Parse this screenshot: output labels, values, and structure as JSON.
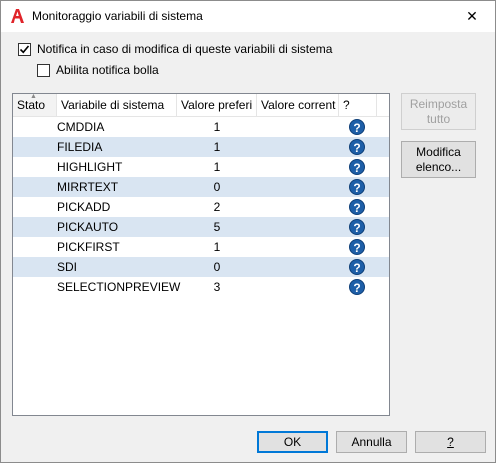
{
  "window": {
    "title": "Monitoraggio variabili di sistema",
    "close_label": "✕"
  },
  "options": {
    "notify_label": "Notifica in caso di modifica di queste variabili di sistema",
    "notify_checked": true,
    "balloon_label": "Abilita notifica bolla",
    "balloon_checked": false
  },
  "table": {
    "columns": [
      "Stato",
      "Variabile di sistema",
      "Valore preferi",
      "Valore corrent",
      "?"
    ],
    "rows": [
      {
        "variable": "CMDDIA",
        "value": "1"
      },
      {
        "variable": "FILEDIA",
        "value": "1"
      },
      {
        "variable": "HIGHLIGHT",
        "value": "1"
      },
      {
        "variable": "MIRRTEXT",
        "value": "0"
      },
      {
        "variable": "PICKADD",
        "value": "2"
      },
      {
        "variable": "PICKAUTO",
        "value": "5"
      },
      {
        "variable": "PICKFIRST",
        "value": "1"
      },
      {
        "variable": "SDI",
        "value": "0"
      },
      {
        "variable": "SELECTIONPREVIEW",
        "value": "3"
      }
    ],
    "help_glyph": "?"
  },
  "buttons": {
    "reset_line1": "Reimposta",
    "reset_line2": "tutto",
    "modify_line1": "Modifica",
    "modify_line2": "elenco...",
    "ok": "OK",
    "cancel": "Annulla",
    "help": "?"
  },
  "colors": {
    "row_alt": "#d9e5f2",
    "help_icon": "#1e5fa8",
    "accent": "#0078d7",
    "app_icon": "#e0242a"
  }
}
